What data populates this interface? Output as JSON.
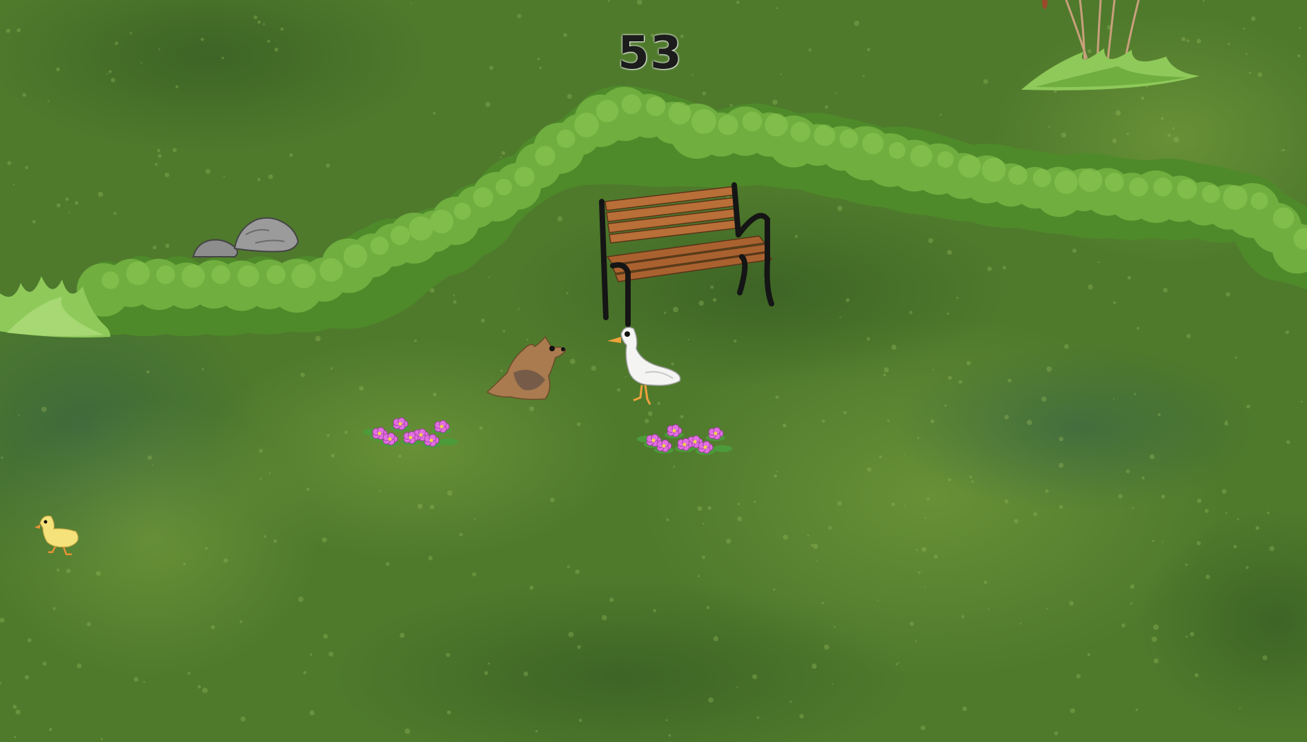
{
  "hud": {
    "score": "53"
  },
  "scene": {
    "setting": "park-lawn",
    "colors": {
      "grass": "#4f7a2c",
      "grass_light": "#6a9437",
      "grass_dark": "#3c6122",
      "hedge": "#6fae3f",
      "hedge_dark": "#4f8a2a",
      "bench_wood": "#b86f38",
      "bench_frame": "#151515",
      "flower": "#e06ee0",
      "score_text": "#1c1c1c"
    },
    "entities": [
      "hedge",
      "bench",
      "rocks",
      "grass-tuft",
      "reeds",
      "dog",
      "goose",
      "duckling",
      "flower-patch"
    ]
  }
}
